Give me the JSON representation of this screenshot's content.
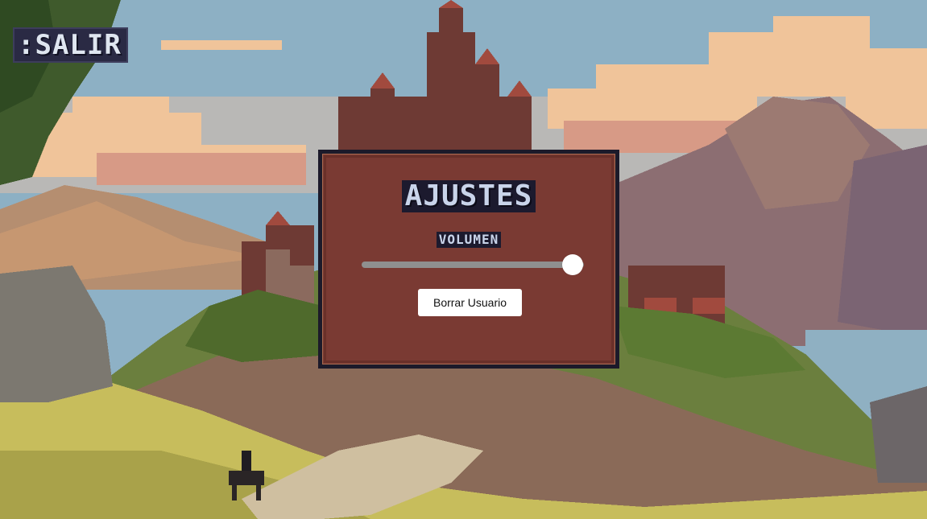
{
  "exit": {
    "label": ":SALIR"
  },
  "settings": {
    "title": "AJUSTES",
    "volume_label": "VOLUMEN",
    "volume_value": 0.95,
    "delete_user_label": "Borrar Usuario"
  },
  "colors": {
    "panel_background": "#7a3a33",
    "panel_border": "#1c1a2a",
    "label_background": "#1c1a2e",
    "label_text": "#c9d4ea",
    "slider_track": "#8f8f8f",
    "slider_thumb": "#ffffff"
  },
  "background": {
    "scene": "pixel-art castle on hill with mountains, clouds, lake and rider"
  }
}
